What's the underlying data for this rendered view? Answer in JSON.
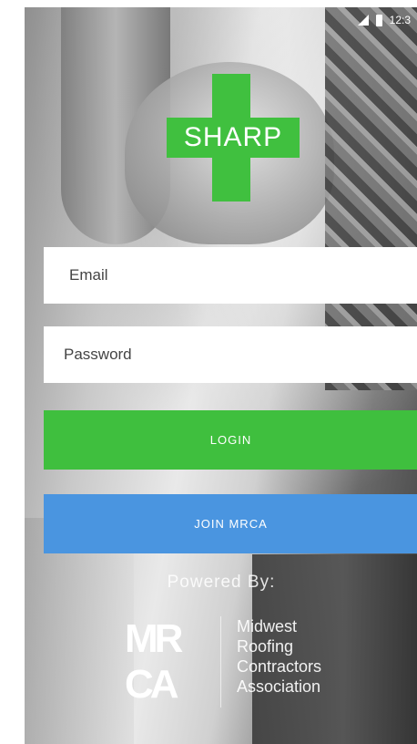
{
  "status_bar": {
    "time": "12:3",
    "icons": [
      "signal-icon",
      "battery-icon"
    ]
  },
  "logo": {
    "text": "SHARP",
    "color": "#40c03f"
  },
  "form": {
    "email_placeholder": "Email",
    "password_placeholder": "Password"
  },
  "buttons": {
    "login_label": "LOGIN",
    "login_color": "#3fbf3e",
    "join_label": "JOIN MRCA",
    "join_color": "#4a95e0"
  },
  "footer": {
    "powered_by": "Powered By:",
    "mrca_mark_top": "MR",
    "mrca_mark_bottom": "CA",
    "org_name_lines": [
      "Midwest",
      "Roofing",
      "Contractors",
      "Association"
    ]
  }
}
